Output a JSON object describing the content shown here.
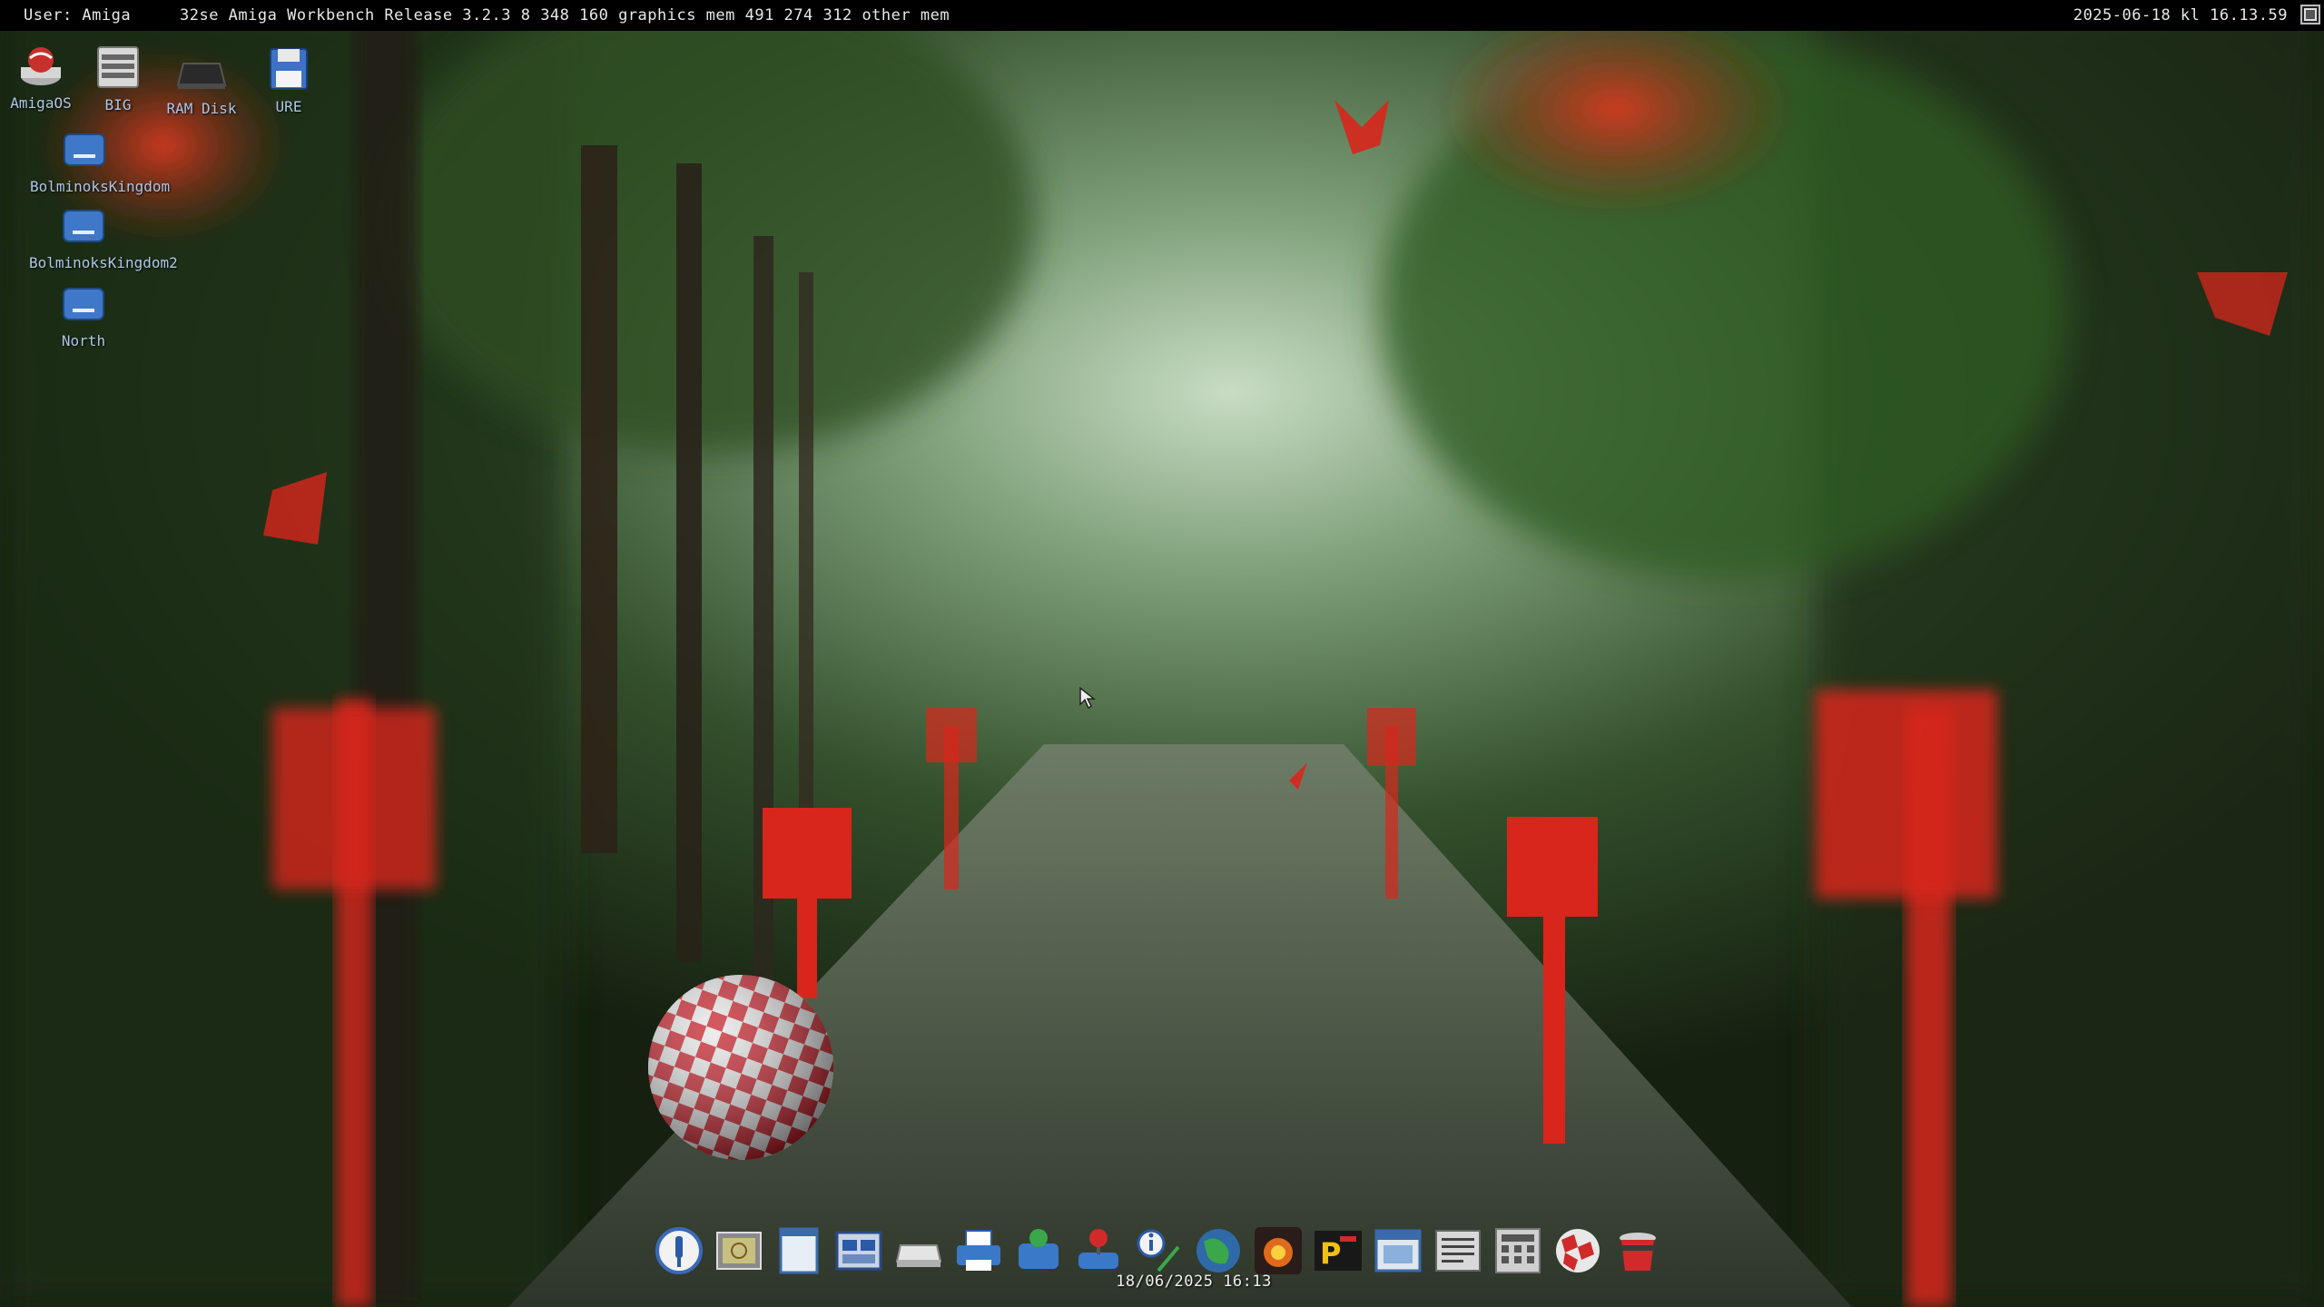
{
  "screen": {
    "user_label": "User: Amiga",
    "release_info": "32se Amiga Workbench Release 3.2.3  8 348 160 graphics mem  491 274 312 other mem",
    "clock": "2025-06-18 kl 16.13.59"
  },
  "desktop_icons": [
    {
      "label": "AmigaOS",
      "icon": "amigaos-boot-disk-icon"
    },
    {
      "label": "BIG",
      "icon": "hard-drive-icon"
    },
    {
      "label": "RAM Disk",
      "icon": "ram-disk-icon"
    },
    {
      "label": "URE",
      "icon": "floppy-disk-icon"
    },
    {
      "label": "BolminoksKingdom",
      "icon": "network-drive-icon"
    },
    {
      "label": "BolminoksKingdom2",
      "icon": "network-drive-icon"
    },
    {
      "label": "North",
      "icon": "network-drive-icon"
    }
  ],
  "dock": {
    "clock": "18/06/2025 16:13",
    "items": [
      "amiga-menu-icon",
      "screen-grid-icon",
      "notepad-icon",
      "file-manager-icon",
      "drive-icon",
      "printer-icon",
      "network-share-icon",
      "joystick-icon",
      "info-icon",
      "chart-tool-icon",
      "globe-icon",
      "game-icon",
      "paint-icon",
      "window-icon",
      "text-editor-icon",
      "calculator-icon",
      "boing-ball-icon",
      "trashcan-icon"
    ]
  },
  "colors": {
    "screenbar_bg": "#000000",
    "screenbar_text": "#e8e8e8",
    "icon_label": "#aec6e6",
    "lantern_red": "#d8261c"
  }
}
